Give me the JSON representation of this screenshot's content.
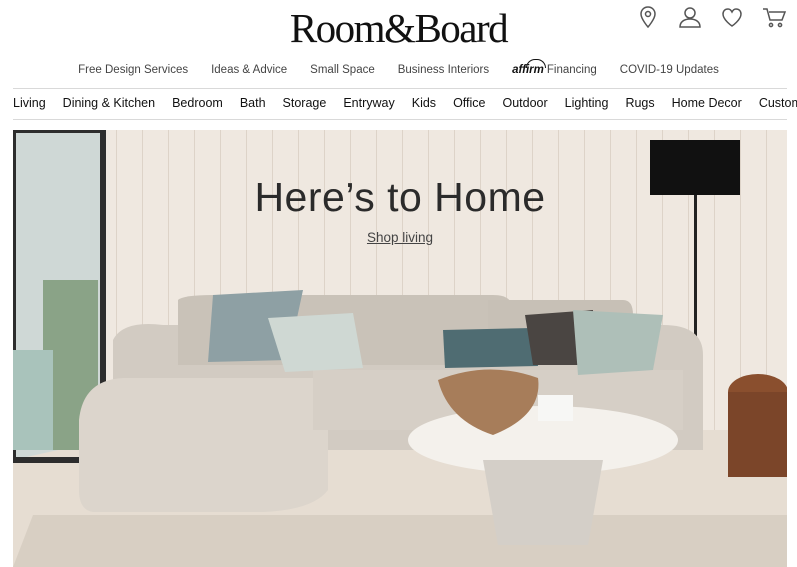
{
  "brand": {
    "logo_text": "Room&Board"
  },
  "utility_icons": [
    "location-pin-icon",
    "account-icon",
    "favorites-heart-icon",
    "cart-icon"
  ],
  "top_nav": {
    "items": [
      "Free Design Services",
      "Ideas & Advice",
      "Small Space",
      "Business Interiors"
    ],
    "financing": {
      "brand": "affirm",
      "label": "Financing"
    },
    "covid": "COVID-19 Updates"
  },
  "category_nav": {
    "items": [
      "Living",
      "Dining & Kitchen",
      "Bedroom",
      "Bath",
      "Storage",
      "Entryway",
      "Kids",
      "Office",
      "Outdoor",
      "Lighting",
      "Rugs",
      "Home Decor",
      "Custom"
    ]
  },
  "hero": {
    "title": "Here’s to Home",
    "link": "Shop living"
  },
  "colors": {
    "text": "#222222",
    "nav_text": "#444444",
    "divider": "#d9d9d9",
    "hero_bg": "#eee7df"
  }
}
